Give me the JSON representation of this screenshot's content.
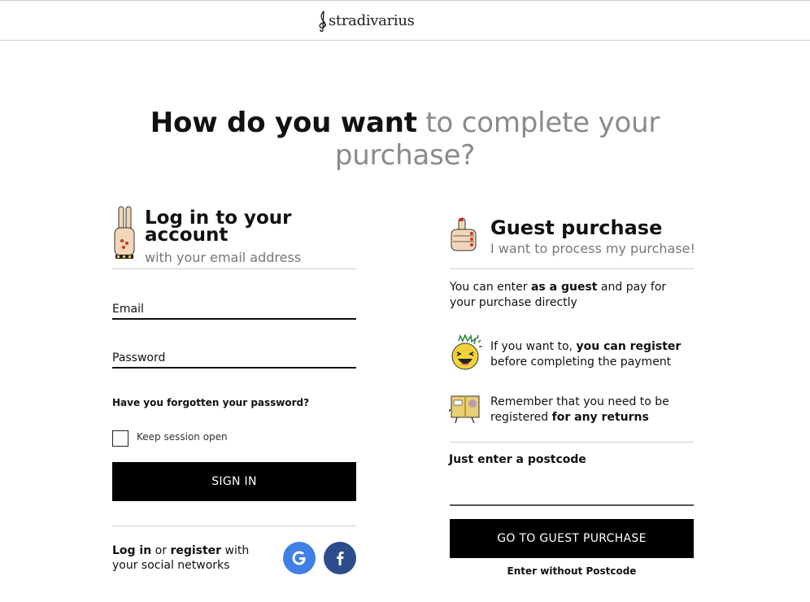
{
  "header": {
    "logo_text": "stradivarius"
  },
  "headline": {
    "strong": "How do you want",
    "soft_line1": " to complete your",
    "soft_line2": "purchase?"
  },
  "login": {
    "title": "Log in to your account",
    "subtitle": "with your email address",
    "email_label": "Email",
    "password_label": "Password",
    "forgot_link": "Have you forgotten your password?",
    "keep_session_label": "Keep session open",
    "keep_session_checked": false,
    "signin_button": "SIGN IN",
    "social": {
      "login_word": "Log in",
      "or_word": " or ",
      "register_word": "register",
      "rest": " with your social networks",
      "google_icon": "google-icon",
      "facebook_icon": "facebook-icon"
    }
  },
  "guest": {
    "title": "Guest purchase",
    "subtitle": "I want to process my purchase!",
    "intro_a": "You can enter ",
    "intro_b": "as a guest",
    "intro_c": " and pay for your purchase directly",
    "register_a": "If you want to, ",
    "register_b": "you can register",
    "register_c": " before completing the payment",
    "returns_a": "Remember that you need to be registered ",
    "returns_b": "for any returns",
    "postcode_label": "Just enter a postcode",
    "postcode_value": "",
    "go_button": "GO TO GUEST PURCHASE",
    "no_postcode_link": "Enter without Postcode"
  },
  "colors": {
    "button_bg": "#000000",
    "google_bg": "#3f7fe6",
    "facebook_bg": "#2d4c8e",
    "muted_text": "#8a8a8a"
  }
}
